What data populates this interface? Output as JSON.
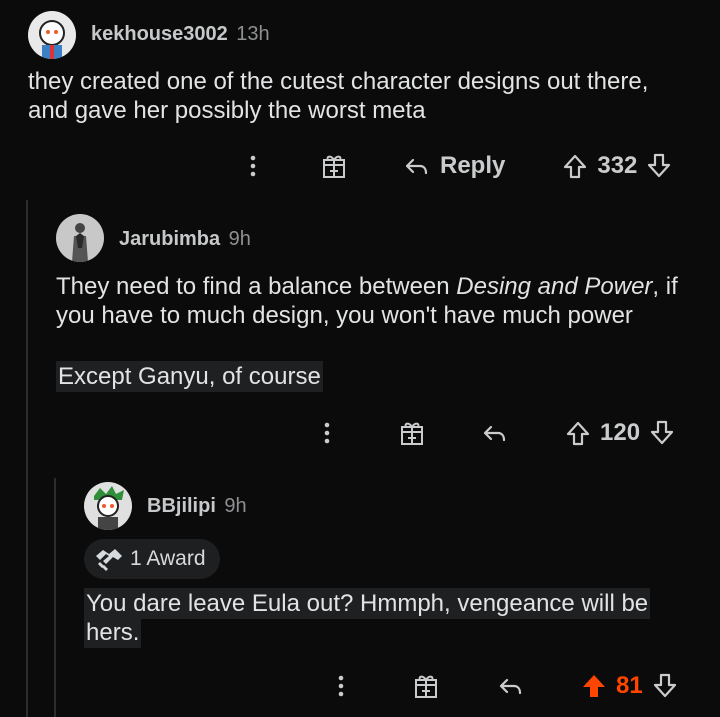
{
  "comments": [
    {
      "username": "kekhouse3002",
      "time": "13h",
      "lines": [
        "they created one of the cutest character designs out there,",
        "and gave her possibly the worst meta"
      ],
      "reply_label": "Reply",
      "score": "332"
    },
    {
      "username": "Jarubimba",
      "time": "9h",
      "line1_pre": "They need to find a balance between ",
      "line1_em": "Desing and Power",
      "line1_post": ", if",
      "line2": "you have to much design, you won't have much power",
      "quote": "Except Ganyu, of course",
      "score": "120"
    },
    {
      "username": "BBjilipi",
      "time": "9h",
      "award": "1 Award",
      "lines": [
        "You dare leave Eula out? Hmmph, vengeance will be",
        "hers."
      ],
      "score": "81"
    }
  ],
  "colors": {
    "upvoted": "#ff4500",
    "text": "#e2e3e4",
    "muted": "#8e9092"
  },
  "icons": [
    "more-vertical-icon",
    "gift-award-icon",
    "reply-arrow-icon",
    "upvote-icon",
    "downvote-icon"
  ]
}
